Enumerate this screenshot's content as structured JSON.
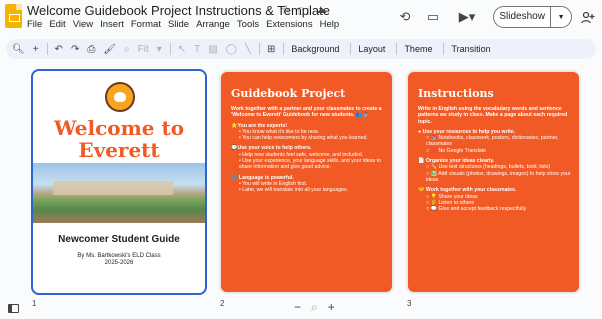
{
  "header": {
    "title": "Welcome Guidebook Project Instructions & Template",
    "menu": [
      "File",
      "Edit",
      "View",
      "Insert",
      "Format",
      "Slide",
      "Arrange",
      "Tools",
      "Extensions",
      "Help"
    ],
    "slideshow_label": "Slideshow"
  },
  "toolbar": {
    "fit_label": "Fit",
    "background_label": "Background",
    "layout_label": "Layout",
    "theme_label": "Theme",
    "transition_label": "Transition"
  },
  "slides": [
    {
      "number": "1",
      "title": "Welcome to Everett",
      "subtitle": "Newcomer Student Guide",
      "byline": "By Ms. Bartkowski's ELD Class",
      "year": "2025-2026"
    },
    {
      "number": "2",
      "title": "Guidebook Project",
      "lead": "Work together with a partner and your classmates to create a 'Welcome to Everett' Guidebook for new students. 👥📚",
      "sections": [
        {
          "heading": "⭐You are the experts!",
          "items": [
            "• You know what it's like to be new.",
            "• You can help newcomers by sharing what you learned."
          ]
        },
        {
          "heading": "💬Use your voice to help others.",
          "items": [
            "• Help new students feel safe, welcome, and included.",
            "• Use your experience, your language skills, and your ideas to share information and give good advice."
          ]
        },
        {
          "heading": "🌐 Language is powerful.",
          "items": [
            "• You will write in English first.",
            "• Later, we will translate into all your languages."
          ]
        }
      ]
    },
    {
      "number": "3",
      "title": "Instructions",
      "lead": "Write in English using the vocabulary words and sentence patterns we study in class. Make a page about each required topic.",
      "sections": [
        {
          "heading": "● Use your resources to help you write.",
          "items": [
            "○ 📚 Notebooks, classwork, posters, dictionaries, partner, classmates",
            "○ ❌ No Google Translate"
          ]
        },
        {
          "heading": "📄 Organize your ideas clearly.",
          "items": [
            "○ ✏️ Use text structures (headings, bullets, bold, lists)",
            "○ 🖼️ Add visuals (photos, drawings, images) to help show your ideas"
          ]
        },
        {
          "heading": "🤝 Work together with your classmates.",
          "items": [
            "○ 💡 Share your ideas",
            "○ 👂 Listen to others",
            "○ 🗨️ Give and accept feedback respectfully"
          ]
        }
      ]
    }
  ],
  "icons": {
    "app_logo": "slides-logo-icon",
    "accent_orange": "#f15a24",
    "selection_blue": "#2e63d0"
  }
}
